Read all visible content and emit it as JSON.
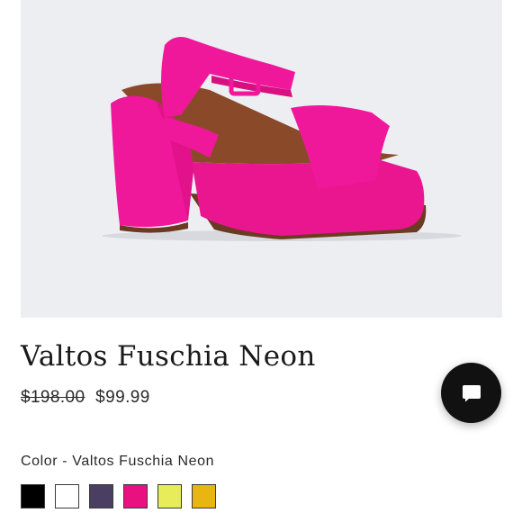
{
  "product": {
    "image_alt": "Pink platform sandal with ankle strap",
    "title": "Valtos Fuschia Neon",
    "price_original": "$198.00",
    "price_sale": "$99.99"
  },
  "color_selector": {
    "label": "Color - Valtos Fuschia Neon",
    "selected": "Valtos Fuschia Neon",
    "swatches": [
      {
        "color": "#000000"
      },
      {
        "color": "#ffffff"
      },
      {
        "color": "#4a3f63"
      },
      {
        "color": "#e8117f"
      },
      {
        "color": "#e6ec5a"
      },
      {
        "color": "#e8b511"
      }
    ]
  },
  "chat": {
    "icon": "chat-bubble-icon"
  },
  "colors": {
    "image_bg": "#eceef2",
    "shoe_pink": "#f0189a",
    "chat_bg": "#111111"
  }
}
